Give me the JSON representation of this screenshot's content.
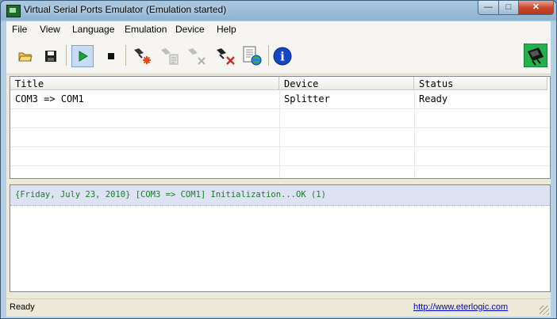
{
  "window": {
    "title": "Virtual Serial Ports Emulator (Emulation started)",
    "controls": {
      "minimize": "—",
      "maximize": "□",
      "close": "✕"
    }
  },
  "menu": [
    "File",
    "View",
    "Language",
    "Emulation",
    "Device",
    "Help"
  ],
  "toolbar": {
    "buttons": [
      {
        "name": "open-folder-icon",
        "enabled": true
      },
      {
        "name": "save-disk-icon",
        "enabled": true
      },
      {
        "name": "play-icon",
        "enabled": true,
        "active": true
      },
      {
        "name": "stop-icon",
        "enabled": true
      },
      {
        "name": "new-device-icon",
        "enabled": true
      },
      {
        "name": "device-properties-icon",
        "enabled": false
      },
      {
        "name": "device-disable-icon",
        "enabled": false
      },
      {
        "name": "delete-device-icon",
        "enabled": true
      },
      {
        "name": "network-settings-icon",
        "enabled": true
      },
      {
        "name": "info-icon",
        "enabled": true
      }
    ],
    "info_glyph": "i"
  },
  "device_table": {
    "columns": [
      "Title",
      "Device",
      "Status"
    ],
    "rows": [
      {
        "title": "COM3 => COM1",
        "device": "Splitter",
        "status": "Ready"
      }
    ]
  },
  "log": [
    "{Friday, July 23, 2010} [COM3 => COM1] Initialization...OK (1)"
  ],
  "statusbar": {
    "text": "Ready",
    "link": "http://www.eterlogic.com"
  },
  "colors": {
    "log_text": "#1d7a2a",
    "log_highlight": "#dde3f3",
    "play_green": "#14a53a",
    "info_blue": "#1446c8",
    "delete_red": "#d22a1a"
  }
}
